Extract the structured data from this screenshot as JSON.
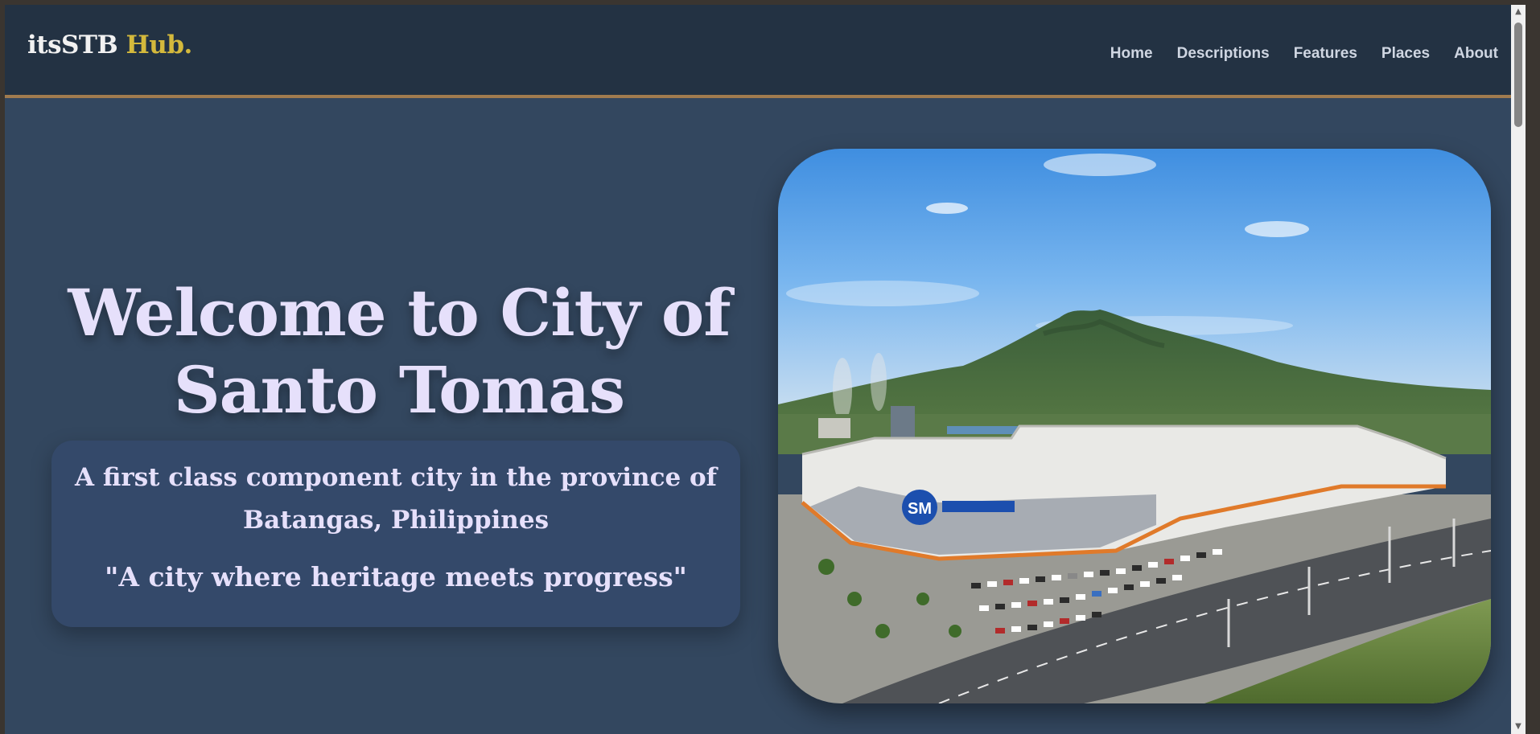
{
  "navbar": {
    "brand_main": "itsSTB",
    "brand_accent": "Hub.",
    "links": [
      {
        "label": "Home"
      },
      {
        "label": "Descriptions"
      },
      {
        "label": "Features"
      },
      {
        "label": "Places"
      },
      {
        "label": "About"
      }
    ]
  },
  "hero": {
    "title_line1": "Welcome to City of",
    "title_line2": "Santo Tomas",
    "tagline": "A first class component city in the province of Batangas, Philippines",
    "motto": "\"A city where heritage meets progress\"",
    "photo": {
      "signage": "SM"
    }
  },
  "colors": {
    "navbar_bg": "#233243",
    "page_bg": "#33475f",
    "nav_border": "#a07b4f",
    "brand_accent": "#d4b93c",
    "title_text": "#e6e0fb"
  },
  "icons": {
    "scroll_up": "triangle-up-icon",
    "scroll_down": "triangle-down-icon"
  }
}
